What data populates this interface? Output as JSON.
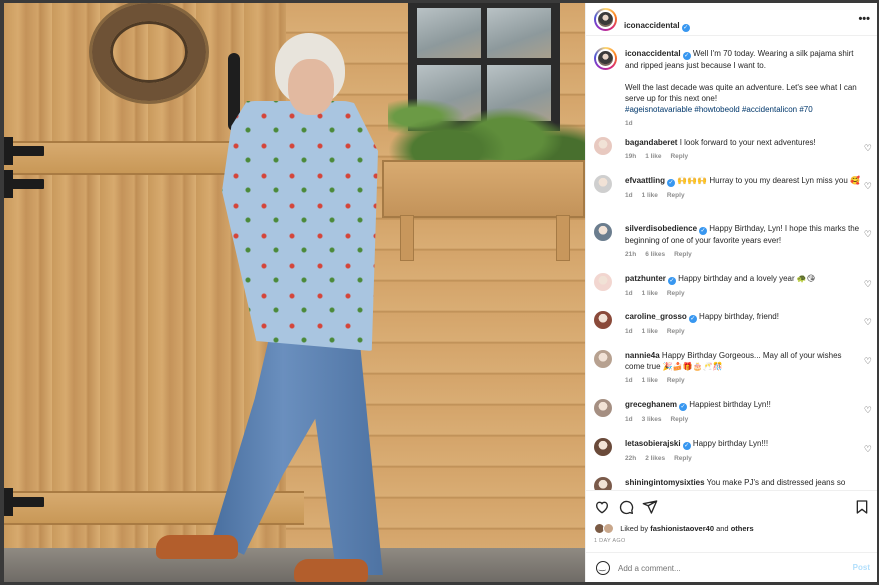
{
  "post": {
    "author": "iconaccidental",
    "verified": true,
    "more_icon": "more-horizontal-icon"
  },
  "caption": {
    "username": "iconaccidental",
    "text_line1": "Well I'm 70 today. Wearing a silk pajama shirt and ripped jeans just because I want to.",
    "text_line2": "Well the last decade was quite an adventure. Let's see what I can serve up for this next one!",
    "hashtags": "#ageisnotavariable #howtobeold #accidentalicon #70",
    "age": "1d"
  },
  "comments": [
    {
      "username": "bagandaberet",
      "verified": false,
      "text": "I look forward to your next adventures!",
      "age": "19h",
      "likes": "1 like",
      "reply": "Reply"
    },
    {
      "username": "efvaattling",
      "verified": true,
      "text": "🙌🙌🙌 Hurray to you my dearest Lyn miss you 🥰",
      "age": "1d",
      "likes": "1 like",
      "reply": "Reply"
    },
    {
      "username": "silverdisobedience",
      "verified": true,
      "text": "Happy Birthday, Lyn! I hope this marks the beginning of one of your favorite years ever!",
      "age": "21h",
      "likes": "6 likes",
      "reply": "Reply"
    },
    {
      "username": "patzhunter",
      "verified": true,
      "text": "Happy birthday and a lovely year 🐢😘",
      "age": "1d",
      "likes": "1 like",
      "reply": "Reply"
    },
    {
      "username": "caroline_grosso",
      "verified": true,
      "text": "Happy birthday, friend!",
      "age": "1d",
      "likes": "1 like",
      "reply": "Reply"
    },
    {
      "username": "nannie4a",
      "verified": false,
      "text": "Happy Birthday Gorgeous... May all of your wishes come true 🎉🍰🎁🎂🥂🎊",
      "age": "1d",
      "likes": "1 like",
      "reply": "Reply"
    },
    {
      "username": "greceghanem",
      "verified": true,
      "text": "Happiest birthday Lyn!!",
      "age": "1d",
      "likes": "3 likes",
      "reply": "Reply"
    },
    {
      "username": "letasobierajski",
      "verified": true,
      "text": "Happy birthday Lyn!!!",
      "age": "22h",
      "likes": "2 likes",
      "reply": "Reply"
    },
    {
      "username": "shiningintomysixties",
      "verified": false,
      "text": "You make PJ's and distressed jeans so",
      "age": "",
      "likes": "",
      "reply": ""
    }
  ],
  "actions": {
    "like_icon": "heart-icon",
    "comment_icon": "comment-icon",
    "share_icon": "send-icon",
    "save_icon": "bookmark-icon",
    "liked_prefix": "Liked by",
    "liked_user": "fashionistaover40",
    "liked_and": "and",
    "liked_others": "others",
    "date": "1 DAY AGO"
  },
  "add_comment": {
    "placeholder": "Add a comment...",
    "post_label": "Post",
    "emoji_icon": "emoji-icon"
  },
  "colors": {
    "link": "#00376b",
    "verified": "#3897f0",
    "post_disabled": "#b2dffc"
  }
}
